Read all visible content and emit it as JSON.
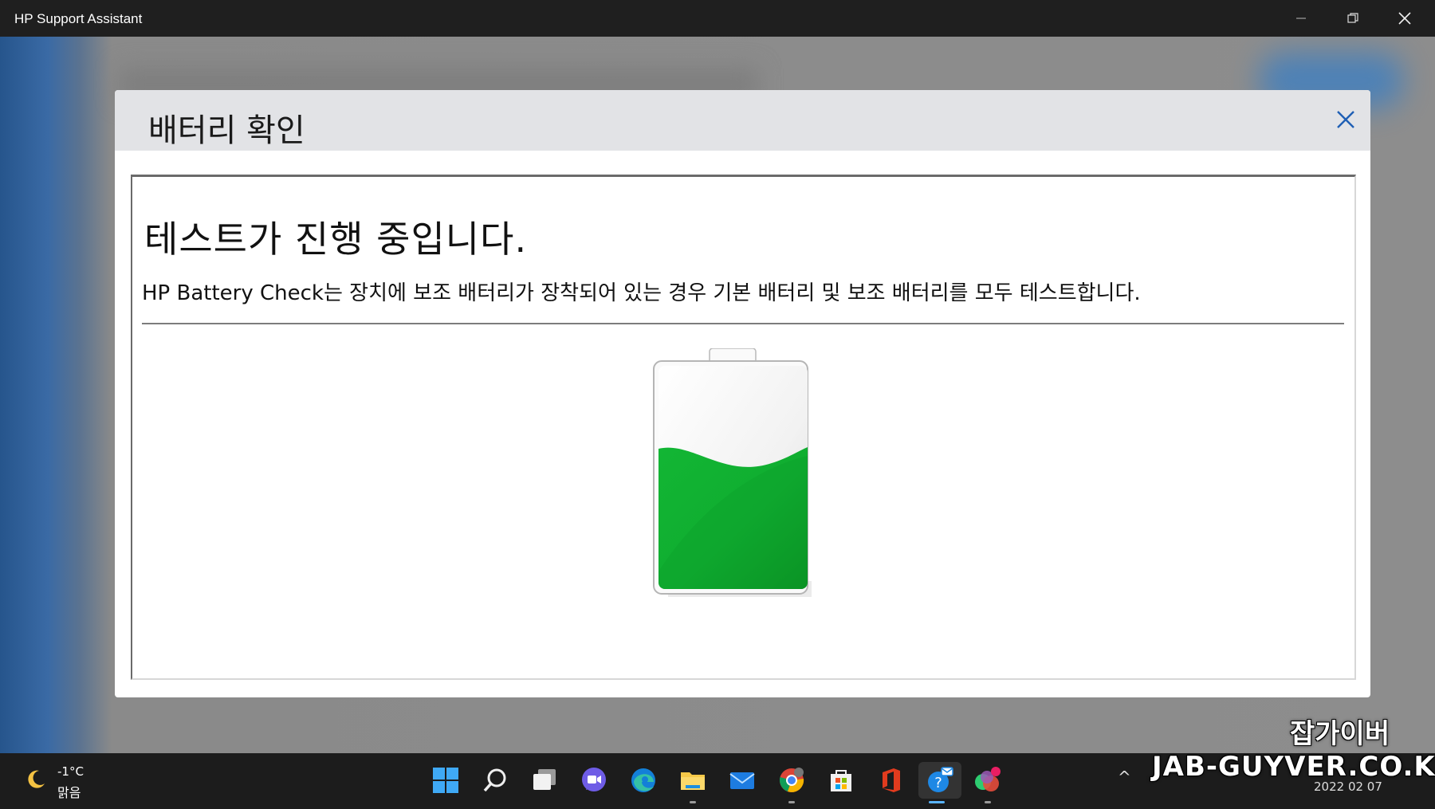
{
  "window": {
    "title": "HP Support Assistant",
    "controls": {
      "minimize": "—",
      "maximize": "❐",
      "close": "✕"
    }
  },
  "dialog": {
    "title": "배터리 확인",
    "heading": "테스트가 진행 중입니다.",
    "description": "HP Battery Check는 장치에 보조 배터리가 장착되어 있는 경우 기본 배터리 및 보조 배터리를 모두 테스트합니다.",
    "battery": {
      "fill_fraction": 0.6,
      "fill_color": "#16a832"
    },
    "close_icon": "close-icon"
  },
  "taskbar": {
    "weather": {
      "temp": "-1°C",
      "condition": "맑음",
      "icon": "moon-icon"
    },
    "apps": [
      {
        "name": "start",
        "icon": "windows-logo-icon"
      },
      {
        "name": "search",
        "icon": "search-icon"
      },
      {
        "name": "task-view",
        "icon": "task-view-icon"
      },
      {
        "name": "chat",
        "icon": "chat-icon"
      },
      {
        "name": "edge",
        "icon": "edge-icon"
      },
      {
        "name": "file-explorer",
        "icon": "folder-icon"
      },
      {
        "name": "mail",
        "icon": "mail-icon"
      },
      {
        "name": "chrome",
        "icon": "chrome-icon"
      },
      {
        "name": "store",
        "icon": "store-icon"
      },
      {
        "name": "office",
        "icon": "office-icon"
      },
      {
        "name": "hp-support-assistant",
        "icon": "help-icon"
      },
      {
        "name": "app-colorful",
        "icon": "app-icon"
      }
    ],
    "tray_chevron": "^",
    "date": "2022 02 07"
  },
  "watermark": {
    "korean": "잡가이버",
    "url": "JAB-GUYVER.CO.KR"
  }
}
